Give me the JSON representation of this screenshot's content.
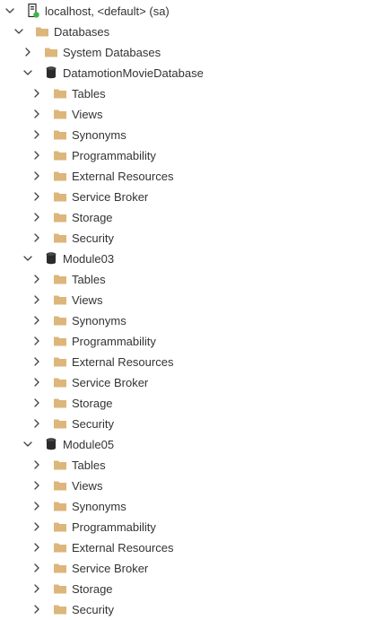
{
  "colors": {
    "folder": "#dcb67a",
    "text": "#333333",
    "chevron": "#424242",
    "database": "#2b2b2b",
    "status_connected": "#3bb54a"
  },
  "tree": {
    "root": {
      "label": "localhost, <default> (sa)",
      "icon": "server-icon",
      "status": "connected",
      "expanded": true
    },
    "databases_folder": {
      "label": "Databases",
      "icon": "folder-icon",
      "expanded": true
    },
    "system_databases": {
      "label": "System Databases",
      "icon": "folder-icon",
      "expanded": false
    },
    "databases": [
      {
        "label": "DatamotionMovieDatabase",
        "icon": "database-icon",
        "expanded": true,
        "children": [
          "Tables",
          "Views",
          "Synonyms",
          "Programmability",
          "External Resources",
          "Service Broker",
          "Storage",
          "Security"
        ]
      },
      {
        "label": "Module03",
        "icon": "database-icon",
        "expanded": true,
        "children": [
          "Tables",
          "Views",
          "Synonyms",
          "Programmability",
          "External Resources",
          "Service Broker",
          "Storage",
          "Security"
        ]
      },
      {
        "label": "Module05",
        "icon": "database-icon",
        "expanded": true,
        "children": [
          "Tables",
          "Views",
          "Synonyms",
          "Programmability",
          "External Resources",
          "Service Broker",
          "Storage",
          "Security"
        ]
      }
    ]
  }
}
